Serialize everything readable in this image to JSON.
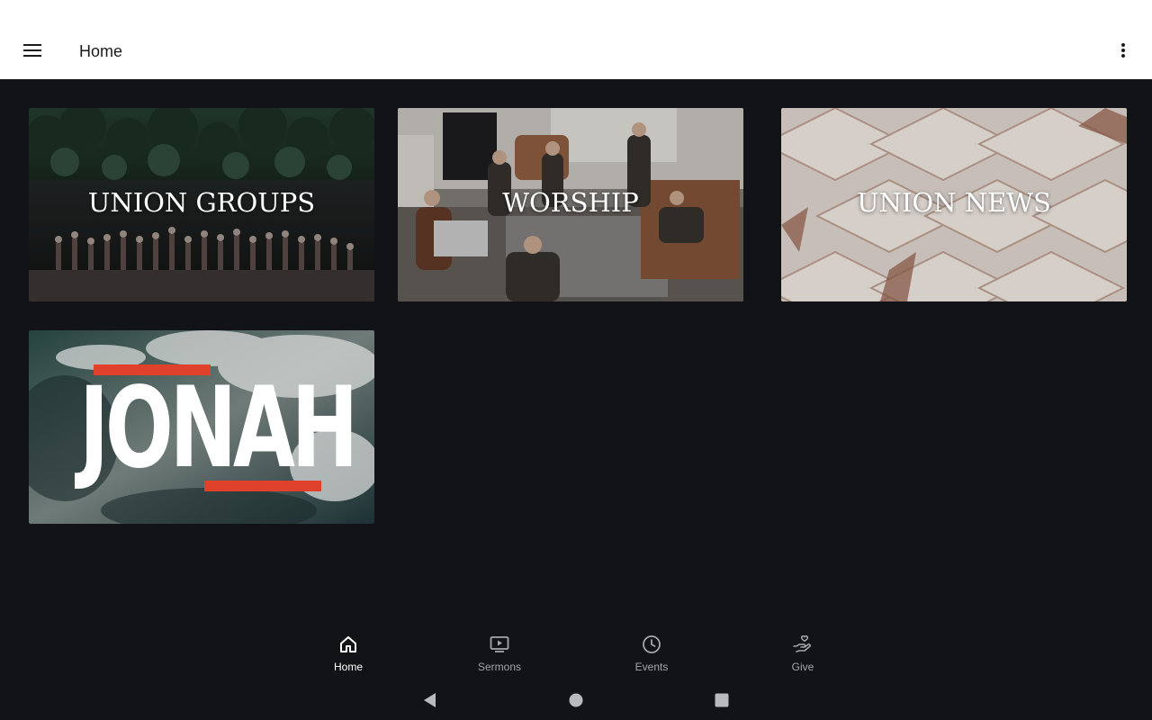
{
  "appbar": {
    "title": "Home",
    "menu_icon": "hamburger-menu-icon",
    "overflow_icon": "more-vert-icon"
  },
  "tiles": [
    {
      "label": "UNION GROUPS",
      "image": "lake-crowd-photo"
    },
    {
      "label": "WORSHIP",
      "image": "living-room-band-photo"
    },
    {
      "label": "UNION NEWS",
      "image": "envelope-pattern-photo"
    },
    {
      "label": "JONAH",
      "image": "ocean-waves-photo"
    }
  ],
  "bottom_nav": {
    "items": [
      {
        "label": "Home",
        "icon": "home-icon",
        "active": true
      },
      {
        "label": "Sermons",
        "icon": "video-play-icon",
        "active": false
      },
      {
        "label": "Events",
        "icon": "clock-icon",
        "active": false
      },
      {
        "label": "Give",
        "icon": "hand-heart-icon",
        "active": false
      }
    ]
  },
  "system_nav": {
    "back_icon": "back-triangle-icon",
    "home_icon": "home-circle-icon",
    "recents_icon": "recents-square-icon"
  },
  "colors": {
    "background": "#121316",
    "appbar": "#ffffff",
    "accent_red": "#e0412b",
    "nav_inactive": "#a4a6ab"
  }
}
